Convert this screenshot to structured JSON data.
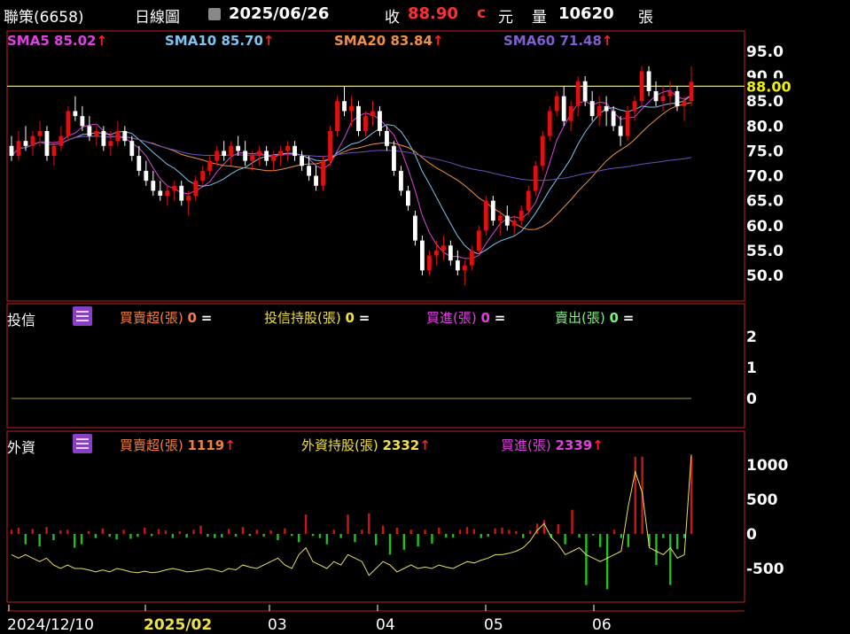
{
  "header": {
    "stock": "聯策(6658)",
    "period": "日線圖",
    "date": "2025/06/26",
    "close_label": "收",
    "close_value": "88.90",
    "close_suffix": "c",
    "unit": "元",
    "volume_label": "量",
    "volume_value": "10620",
    "volume_unit": "張"
  },
  "sma_legend": [
    {
      "label": "SMA5",
      "value": "85.02",
      "color": "#e040e0"
    },
    {
      "label": "SMA10",
      "value": "85.70",
      "color": "#7cc6f0"
    },
    {
      "label": "SMA20",
      "value": "83.84",
      "color": "#f09040"
    },
    {
      "label": "SMA60",
      "value": "71.48",
      "color": "#7050c0"
    }
  ],
  "trust_panel": {
    "title": "投信",
    "items": [
      {
        "label": "買賣超(張)",
        "value": "0",
        "suffix": "=",
        "color": "#f08040"
      },
      {
        "label": "投信持股(張)",
        "value": "0",
        "suffix": "=",
        "color": "#f0e040"
      },
      {
        "label": "買進(張)",
        "value": "0",
        "suffix": "=",
        "color": "#e040e0"
      },
      {
        "label": "賣出(張)",
        "value": "0",
        "suffix": "=",
        "color": "#80f080"
      }
    ]
  },
  "foreign_panel": {
    "title": "外資",
    "items": [
      {
        "label": "買賣超(張)",
        "value": "1119",
        "color": "#f08040"
      },
      {
        "label": "外資持股(張)",
        "value": "2332",
        "color": "#f0e040"
      },
      {
        "label": "買進(張)",
        "value": "2339",
        "color": "#e040e0"
      }
    ]
  },
  "chart_data": [
    {
      "type": "candlestick",
      "y_ticks": [
        "95.0",
        "90.0",
        "85.0",
        "80.0",
        "75.0",
        "70.0",
        "65.0",
        "60.0",
        "55.0",
        "50.0"
      ],
      "ylim": [
        46.5,
        97
      ],
      "reference_line": {
        "value": 88.0,
        "label": "88.00"
      },
      "x_ticks": [
        "2024/12/10",
        "2025/02",
        "03",
        "04",
        "05",
        "06"
      ],
      "ohlc": [
        [
          76,
          78,
          73,
          74
        ],
        [
          74,
          79,
          73,
          77
        ],
        [
          77,
          80,
          75,
          76
        ],
        [
          76,
          79,
          74,
          78
        ],
        [
          78,
          81,
          76,
          79
        ],
        [
          79,
          80,
          73,
          74
        ],
        [
          74,
          77,
          72,
          76
        ],
        [
          76,
          80,
          75,
          78
        ],
        [
          78,
          84,
          77,
          83
        ],
        [
          83,
          86,
          81,
          82
        ],
        [
          82,
          84,
          79,
          80
        ],
        [
          80,
          82,
          77,
          78
        ],
        [
          78,
          80,
          76,
          79
        ],
        [
          79,
          80,
          75,
          76
        ],
        [
          76,
          79,
          74,
          77
        ],
        [
          77,
          81,
          76,
          79
        ],
        [
          79,
          80,
          76,
          77
        ],
        [
          77,
          78,
          73,
          74
        ],
        [
          74,
          76,
          70,
          71
        ],
        [
          71,
          73,
          68,
          69
        ],
        [
          69,
          71,
          66,
          67
        ],
        [
          67,
          69,
          65,
          66
        ],
        [
          66,
          68,
          64,
          67
        ],
        [
          67,
          69,
          65,
          68
        ],
        [
          68,
          69,
          64,
          65
        ],
        [
          65,
          67,
          62,
          66
        ],
        [
          66,
          70,
          65,
          69
        ],
        [
          69,
          72,
          68,
          71
        ],
        [
          71,
          74,
          70,
          73
        ],
        [
          73,
          76,
          72,
          75
        ],
        [
          75,
          77,
          73,
          74
        ],
        [
          74,
          77,
          72,
          76
        ],
        [
          76,
          78,
          74,
          75
        ],
        [
          75,
          77,
          72,
          73
        ],
        [
          73,
          75,
          71,
          74
        ],
        [
          74,
          76,
          72,
          75
        ],
        [
          75,
          76,
          72,
          73
        ],
        [
          73,
          75,
          71,
          74
        ],
        [
          74,
          76,
          72,
          75
        ],
        [
          75,
          77,
          73,
          76
        ],
        [
          76,
          77,
          73,
          74
        ],
        [
          74,
          75,
          71,
          72
        ],
        [
          72,
          74,
          69,
          70
        ],
        [
          70,
          72,
          67,
          68
        ],
        [
          68,
          74,
          67,
          73
        ],
        [
          73,
          80,
          72,
          79
        ],
        [
          79,
          86,
          78,
          85
        ],
        [
          85,
          88,
          82,
          83
        ],
        [
          83,
          86,
          80,
          84
        ],
        [
          84,
          85,
          78,
          79
        ],
        [
          79,
          83,
          78,
          82
        ],
        [
          82,
          85,
          80,
          83
        ],
        [
          83,
          84,
          78,
          79
        ],
        [
          79,
          80,
          75,
          76
        ],
        [
          76,
          77,
          70,
          71
        ],
        [
          71,
          72,
          66,
          67
        ],
        [
          67,
          68,
          63,
          64
        ],
        [
          62,
          63,
          56,
          57
        ],
        [
          57,
          58,
          50,
          51
        ],
        [
          51,
          55,
          50,
          54
        ],
        [
          54,
          57,
          52,
          55
        ],
        [
          55,
          58,
          53,
          56
        ],
        [
          56,
          57,
          52,
          53
        ],
        [
          53,
          55,
          50,
          51
        ],
        [
          51,
          53,
          48,
          52
        ],
        [
          52,
          56,
          51,
          55
        ],
        [
          55,
          60,
          54,
          59
        ],
        [
          59,
          66,
          58,
          65
        ],
        [
          65,
          66,
          60,
          61
        ],
        [
          61,
          63,
          58,
          62
        ],
        [
          62,
          64,
          59,
          60
        ],
        [
          60,
          62,
          58,
          61
        ],
        [
          61,
          64,
          60,
          63
        ],
        [
          63,
          68,
          62,
          67
        ],
        [
          67,
          73,
          66,
          72
        ],
        [
          72,
          79,
          71,
          78
        ],
        [
          78,
          84,
          77,
          83
        ],
        [
          83,
          87,
          82,
          86
        ],
        [
          86,
          88,
          80,
          81
        ],
        [
          81,
          85,
          79,
          84
        ],
        [
          84,
          90,
          82,
          89
        ],
        [
          89,
          90,
          84,
          85
        ],
        [
          85,
          87,
          81,
          82
        ],
        [
          82,
          86,
          80,
          84
        ],
        [
          84,
          86,
          80,
          83
        ],
        [
          83,
          84,
          79,
          80
        ],
        [
          80,
          82,
          76,
          78
        ],
        [
          78,
          84,
          77,
          83
        ],
        [
          83,
          86,
          81,
          85
        ],
        [
          85,
          92,
          84,
          91
        ],
        [
          91,
          92,
          86,
          87
        ],
        [
          87,
          89,
          84,
          85
        ],
        [
          85,
          88,
          83,
          86
        ],
        [
          86,
          89,
          84,
          87
        ],
        [
          87,
          88,
          83,
          84
        ],
        [
          84,
          86,
          81,
          85
        ],
        [
          85,
          92,
          84,
          88.9
        ]
      ],
      "sma_series": [
        "SMA5",
        "SMA10",
        "SMA20",
        "SMA60"
      ]
    },
    {
      "type": "line",
      "title": "投信",
      "y_ticks": [
        "2",
        "1",
        "0"
      ],
      "values": "all zero"
    },
    {
      "type": "bar",
      "title": "外資",
      "y_ticks": [
        "1000",
        "500",
        "0",
        "-500"
      ],
      "ylim": [
        -850,
        1150
      ],
      "net": [
        60,
        90,
        -150,
        70,
        -180,
        100,
        -90,
        50,
        60,
        -200,
        -150,
        40,
        -60,
        80,
        -40,
        -80,
        60,
        -70,
        -40,
        90,
        -30,
        70,
        50,
        -60,
        40,
        -50,
        60,
        120,
        -40,
        -60,
        -50,
        70,
        -40,
        100,
        -30,
        60,
        -40,
        50,
        -90,
        80,
        -30,
        -120,
        280,
        -30,
        -60,
        -150,
        60,
        -60,
        280,
        -120,
        60,
        300,
        -160,
        120,
        -300,
        90,
        -230,
        60,
        -180,
        60,
        -140,
        90,
        -50,
        -50,
        60,
        100,
        70,
        -60,
        -40,
        80,
        90,
        60,
        40,
        -60,
        50,
        150,
        200,
        -50,
        140,
        -150,
        350,
        -50,
        -740,
        -20,
        -190,
        -800,
        60,
        -60,
        -190,
        1119,
        1119,
        -180,
        -450,
        -60,
        -740,
        -220,
        -60,
        1119
      ],
      "holding": [
        -300,
        -350,
        -300,
        -350,
        -400,
        -350,
        -450,
        -500,
        -450,
        -500,
        -500,
        -520,
        -550,
        -520,
        -550,
        -500,
        -520,
        -550,
        -560,
        -540,
        -560,
        -550,
        -520,
        -500,
        -520,
        -550,
        -540,
        -520,
        -500,
        -520,
        -550,
        -500,
        -520,
        -450,
        -480,
        -500,
        -450,
        -400,
        -350,
        -450,
        -500,
        -300,
        -200,
        -400,
        -450,
        -500,
        -400,
        -450,
        -300,
        -350,
        -400,
        -600,
        -500,
        -400,
        -450,
        -550,
        -500,
        -450,
        -500,
        -480,
        -500,
        -450,
        -480,
        -500,
        -450,
        -400,
        -420,
        -380,
        -350,
        -300,
        -300,
        -280,
        -250,
        -200,
        -100,
        50,
        150,
        -50,
        -150,
        -300,
        -250,
        -200,
        -300,
        -350,
        -400,
        -350,
        -300,
        -250,
        400,
        900,
        600,
        -200,
        -250,
        -300,
        -200,
        -350,
        -300,
        2332
      ]
    }
  ]
}
